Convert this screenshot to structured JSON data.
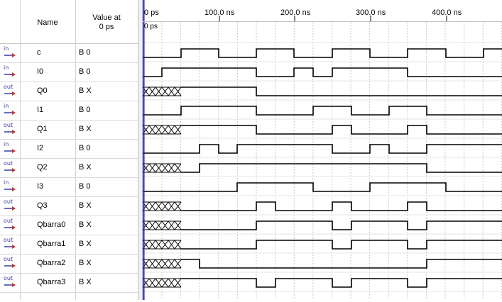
{
  "header": {
    "name_label": "Name",
    "value_label_line1": "Value at",
    "value_label_line2": "0 ps"
  },
  "ruler": {
    "ticks": [
      "0 ps",
      "100.0 ns",
      "200.0 ns",
      "300.0 ns",
      "400.0 ns"
    ],
    "cursor_label": "0 ps"
  },
  "icons": {
    "input": "in",
    "output": "out"
  },
  "signals": [
    {
      "dir": "in",
      "name": "c",
      "value": "B 0"
    },
    {
      "dir": "in",
      "name": "I0",
      "value": "B 0"
    },
    {
      "dir": "out",
      "name": "Q0",
      "value": "B X"
    },
    {
      "dir": "in",
      "name": "I1",
      "value": "B 0"
    },
    {
      "dir": "out",
      "name": "Q1",
      "value": "B X"
    },
    {
      "dir": "in",
      "name": "I2",
      "value": "B 0"
    },
    {
      "dir": "out",
      "name": "Q2",
      "value": "B X"
    },
    {
      "dir": "in",
      "name": "I3",
      "value": "B 0"
    },
    {
      "dir": "out",
      "name": "Q3",
      "value": "B X"
    },
    {
      "dir": "out",
      "name": "Qbarra0",
      "value": "B X"
    },
    {
      "dir": "out",
      "name": "Qbarra1",
      "value": "B X"
    },
    {
      "dir": "out",
      "name": "Qbarra2",
      "value": "B X"
    },
    {
      "dir": "out",
      "name": "Qbarra3",
      "value": "B X"
    }
  ],
  "colors": {
    "cursor": "#1b1bb4",
    "wave": "#000000",
    "grid": "#c8c8c8",
    "icon": "#3a3aa0",
    "icon_arrow": "#c83232"
  }
}
